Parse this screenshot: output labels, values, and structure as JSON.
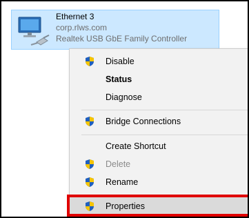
{
  "adapter": {
    "name": "Ethernet 3",
    "domain": "corp.rlws.com",
    "device": "Realtek USB GbE Family Controller"
  },
  "menu": {
    "items": [
      {
        "label": "Disable",
        "icon": "uac-shield-icon"
      },
      {
        "label": "Status"
      },
      {
        "label": "Diagnose"
      },
      {
        "label": "Bridge Connections",
        "icon": "uac-shield-icon"
      },
      {
        "label": "Create Shortcut"
      },
      {
        "label": "Delete",
        "icon": "uac-shield-icon",
        "disabled": true
      },
      {
        "label": "Rename",
        "icon": "uac-shield-icon"
      },
      {
        "label": "Properties",
        "icon": "uac-shield-icon",
        "highlighted": true
      }
    ]
  },
  "colors": {
    "selection_fill": "#cce8ff",
    "selection_border": "#99d1ff",
    "menu_background": "#f2f2f2",
    "callout": "#e00000",
    "shield_blue": "#1f5fbf",
    "shield_yellow": "#f5c400"
  }
}
